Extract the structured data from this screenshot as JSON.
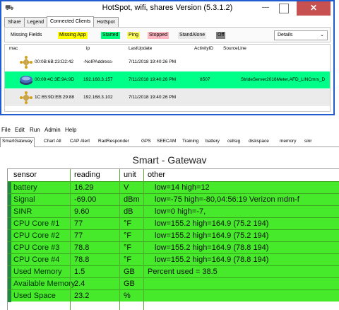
{
  "hotspot": {
    "title": "HotSpot, wifi, shares Version (5.3.1.2)",
    "tabs": [
      "Share",
      "Legend",
      "Connected Clients",
      "HotSpot"
    ],
    "flags": [
      {
        "label": "Missing Fields",
        "color": "#f5f5f5"
      },
      {
        "label": "Missing App",
        "color": "#ffff00"
      },
      {
        "label": "Started",
        "color": "#00ff7f"
      },
      {
        "label": "Ping",
        "color": "#ffff66"
      },
      {
        "label": "Stopped",
        "color": "#ffb6c1"
      },
      {
        "label": "StandAlone",
        "color": "#e8e8e8"
      },
      {
        "label": "Off",
        "color": "#808080"
      }
    ],
    "view_select": "Details",
    "columns": [
      "mac",
      "ip",
      "LastUpdate",
      "ActivityID",
      "SourceLine"
    ],
    "rows": [
      {
        "mac": "00:0B:6B:23:D2:42",
        "ip": "-NoIPAddress-",
        "last_update": "7/11/2018 19:40:26 PM",
        "activity": "",
        "source": "",
        "highlight": false
      },
      {
        "mac": "00:09:4C:3E:9A:9D",
        "ip": "192.168.3.157",
        "last_update": "7/11/2018 19:40:26 PM",
        "activity": "8507",
        "source": "StrideServer2016Meter,AFD_LINCmrs_D",
        "highlight": true
      },
      {
        "mac": "1C:65:9D:EB:29:88",
        "ip": "192.168.3.102",
        "last_update": "7/11/2018 19:40:26 PM",
        "activity": "",
        "source": "",
        "highlight": false
      }
    ],
    "colors": {
      "highlight": "#00ff88",
      "alt_row": "#ebebeb"
    }
  },
  "gateway": {
    "menu": [
      "File",
      "Edit",
      "Run",
      "Admin",
      "Help"
    ],
    "tabs": [
      "SmartGateway",
      "Chart All",
      "CAP Alert",
      "RadResponder",
      "GPS",
      "SEECAM",
      "Training",
      "battery",
      "cellsig",
      "diskspace",
      "memory",
      "sinr"
    ],
    "panel_title": "Smart - Gatewav",
    "columns": [
      "sensor",
      "reading",
      "unit",
      "other"
    ],
    "rows": [
      {
        "sensor": "battery",
        "reading": "16.29",
        "unit": "V",
        "other": "low=14 high=12"
      },
      {
        "sensor": "Signal",
        "reading": "-69.00",
        "unit": "dBm",
        "other": "low=-75 high=-80,04:56:19 Verizon mdm-f"
      },
      {
        "sensor": "SINR",
        "reading": "9.60",
        "unit": "dB",
        "other": "low=0 high=-7,"
      },
      {
        "sensor": "CPU Core #1",
        "reading": "77",
        "unit": "°F",
        "other": "low=155.2 high=164.9 (75.2 194)"
      },
      {
        "sensor": "CPU Core #2",
        "reading": "77",
        "unit": "°F",
        "other": "low=155.2 high=164.9 (75.2 194)"
      },
      {
        "sensor": "CPU Core #3",
        "reading": "78.8",
        "unit": "°F",
        "other": "low=155.2 high=164.9 (78.8 194)"
      },
      {
        "sensor": "CPU Core #4",
        "reading": "78.8",
        "unit": "°F",
        "other": "low=155.2 high=164.9 (78.8 194)"
      },
      {
        "sensor": "Used Memory",
        "reading": "1.5",
        "unit": "GB",
        "other": "Percent used = 38.5"
      },
      {
        "sensor": "Available Memory",
        "reading": "2.4",
        "unit": "GB",
        "other": ""
      },
      {
        "sensor": "Used Space",
        "reading": "23.2",
        "unit": "%",
        "other": ""
      }
    ],
    "colors": {
      "row": "#46ea2b",
      "marker": "#1e8a3a"
    }
  }
}
